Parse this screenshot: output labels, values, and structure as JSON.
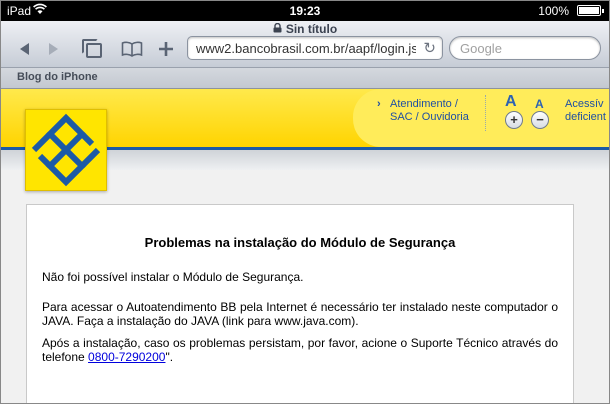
{
  "status_bar": {
    "carrier": "iPad",
    "time": "19:23",
    "battery": "100%"
  },
  "browser": {
    "page_title": "Sin título",
    "url": "www2.bancobrasil.com.br/aapf/login.jsp?...",
    "search_placeholder": "Google",
    "bookmark": "Blog do iPhone"
  },
  "header": {
    "atendimento_line1": "Atendimento /",
    "atendimento_line2": "SAC / Ouvidoria",
    "font_increase_label": "A",
    "font_decrease_label": "A",
    "plus": "+",
    "minus": "−",
    "acess_line1": "Acessív",
    "acess_line2": "deficient"
  },
  "message": {
    "title": "Problemas na instalação do Módulo de Segurança",
    "para1": "Não foi possível instalar o Módulo de Segurança.",
    "para2": "Para acessar o Autoatendimento BB pela Internet é necessário ter instalado neste computador o JAVA. Faça a instalação do JAVA (link para www.java.com).",
    "para3_before": "Após a instalação, caso os problemas persistam, por favor, acione o Suporte Técnico através do telefone ",
    "phone": "0800-7290200",
    "para3_after": "\"."
  },
  "colors": {
    "brand_yellow": "#ffd400",
    "brand_blue": "#1b5aa6",
    "link": "#0000dd"
  }
}
